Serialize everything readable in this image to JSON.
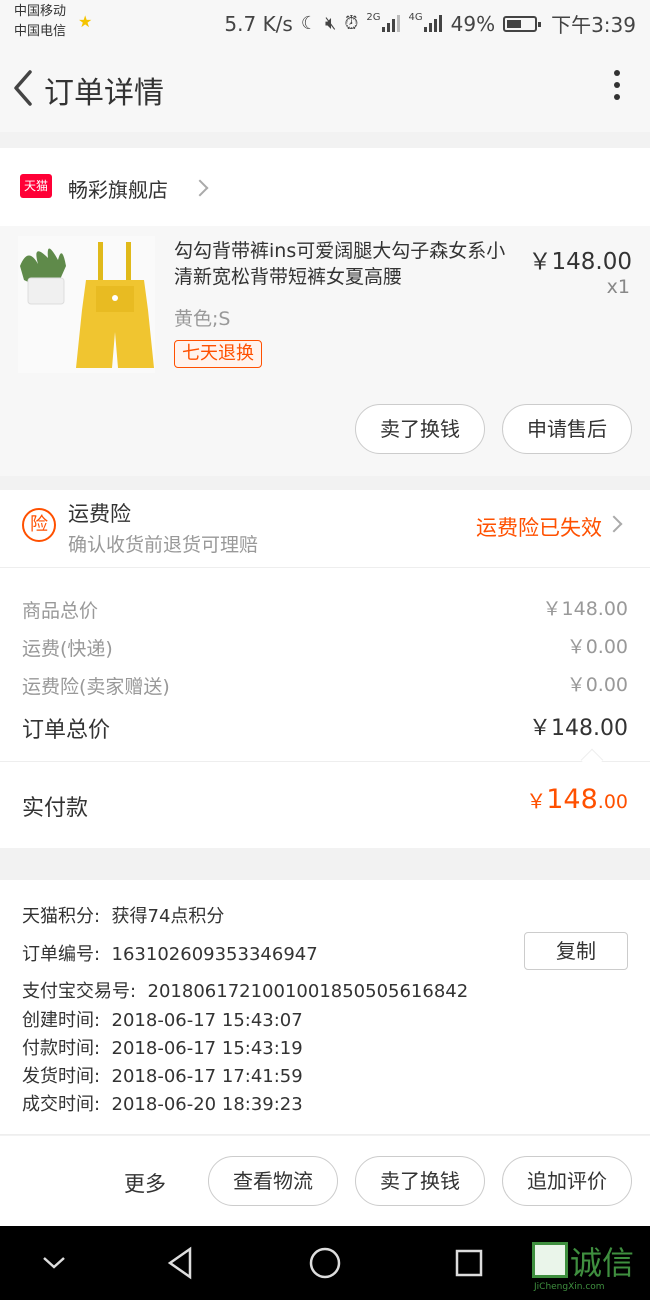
{
  "status_bar": {
    "carrier1": "中国移动",
    "carrier2": "中国电信",
    "speed": "5.7 K/s",
    "net1": "2G",
    "net2": "4G",
    "battery": "49%",
    "time": "下午3:39"
  },
  "header": {
    "title": "订单详情"
  },
  "shop": {
    "tag": "天猫",
    "name": "畅彩旗舰店"
  },
  "product": {
    "title": "勾勾背带裤ins可爱阔腿大勾子森女系小清新宽松背带短裤女夏高腰",
    "price": "￥148.00",
    "quantity": "x1",
    "sku": "黄色;S",
    "badge": "七天退换",
    "actions": [
      "卖了换钱",
      "申请售后"
    ]
  },
  "insurance": {
    "icon_label": "险",
    "title": "运费险",
    "subtitle": "确认收货前退货可理赔",
    "status": "运费险已失效"
  },
  "price_breakdown": {
    "rows": [
      {
        "label": "商品总价",
        "value": "￥148.00"
      },
      {
        "label": "运费(快递)",
        "value": "￥0.00"
      },
      {
        "label": "运费险(卖家赠送)",
        "value": "￥0.00"
      }
    ],
    "total_label": "订单总价",
    "total_value": "￥148.00",
    "paid_label": "实付款",
    "paid_currency": "￥",
    "paid_integer": "148",
    "paid_decimal": ".00"
  },
  "order_info": {
    "points_label": "天猫积分:",
    "points_value": "获得74点积分",
    "order_no_label": "订单编号:",
    "order_no": "163102609353346947",
    "copy_label": "复制",
    "alipay_label": "支付宝交易号:",
    "alipay_no": "2018061721001001850505616842",
    "created_label": "创建时间:",
    "created": "2018-06-17 15:43:07",
    "paid_label": "付款时间:",
    "paid": "2018-06-17 15:43:19",
    "shipped_label": "发货时间:",
    "shipped": "2018-06-17 17:41:59",
    "completed_label": "成交时间:",
    "completed": "2018-06-20 18:39:23"
  },
  "bottom_actions": {
    "more": "更多",
    "buttons": [
      "查看物流",
      "卖了换钱",
      "追加评价"
    ]
  },
  "watermark": {
    "text": "诚信",
    "sub": "JiChengXin.com"
  },
  "colors": {
    "accent": "#ff5000",
    "tmall": "#ff0036"
  }
}
